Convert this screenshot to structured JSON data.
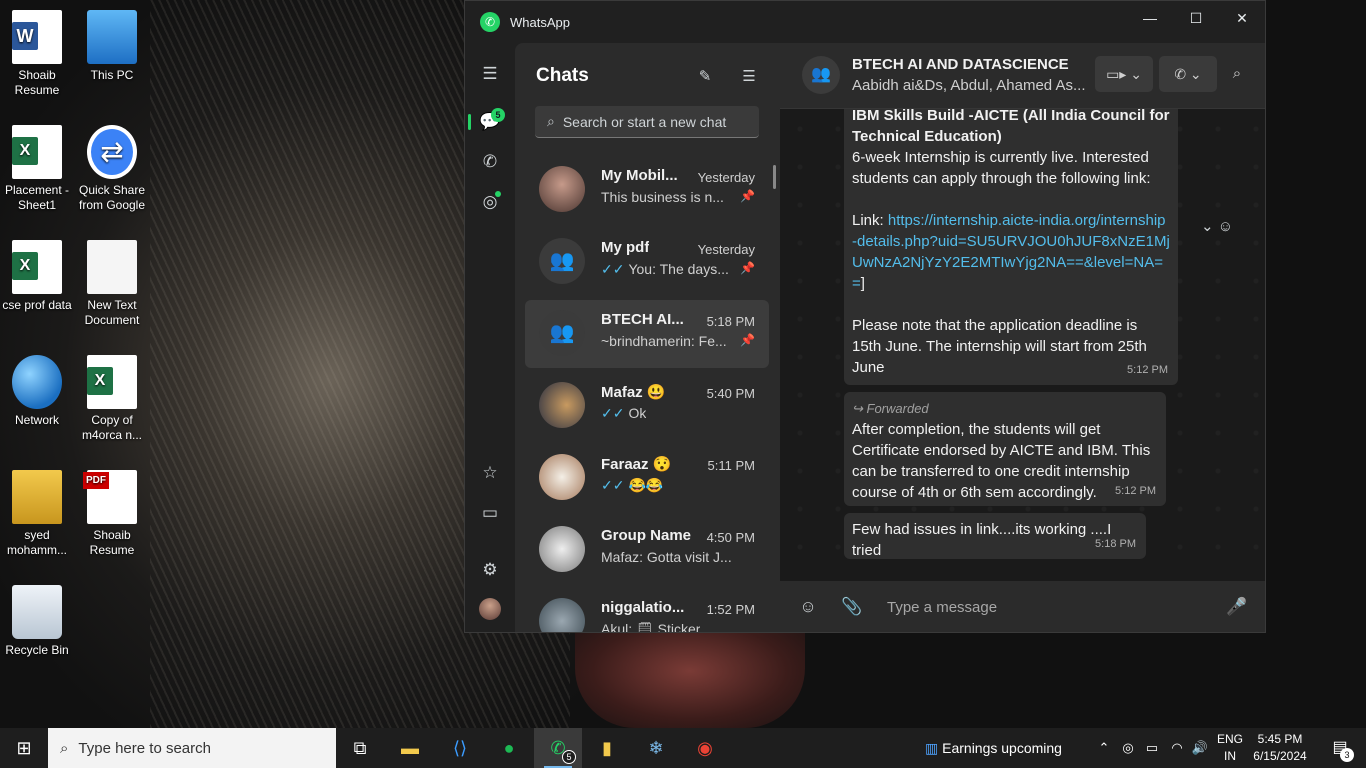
{
  "desktop": {
    "icons": [
      {
        "label": "Shoaib Resume",
        "icon": "word-icon"
      },
      {
        "label": "This PC",
        "icon": "computer-icon"
      },
      {
        "label": "Placement - Sheet1",
        "icon": "excel-icon"
      },
      {
        "label": "Quick Share from Google",
        "icon": "quick-share-icon"
      },
      {
        "label": "cse prof data",
        "icon": "excel-icon"
      },
      {
        "label": "New Text Document",
        "icon": "text-file-icon"
      },
      {
        "label": "Network",
        "icon": "network-icon"
      },
      {
        "label": "Copy of m4orca n...",
        "icon": "excel-icon"
      },
      {
        "label": "syed mohamm...",
        "icon": "user-folder-icon"
      },
      {
        "label": "Shoaib Resume",
        "icon": "pdf-icon"
      },
      {
        "label": "Recycle Bin",
        "icon": "recycle-bin-icon"
      }
    ]
  },
  "window": {
    "title": "WhatsApp",
    "controls": [
      "—",
      "☐",
      "✕"
    ]
  },
  "rail": {
    "menu_icon": "☰",
    "chats_badge": "5",
    "items": [
      "chats-icon",
      "calls-icon",
      "status-icon",
      "starred-icon",
      "archived-icon",
      "settings-icon"
    ]
  },
  "chatlist": {
    "title": "Chats",
    "search_placeholder": "Search or start a new chat",
    "chats": [
      {
        "name": "My Mobil...",
        "time": "Yesterday",
        "preview": "This business is n...",
        "ticks": false,
        "pinned": true
      },
      {
        "name": "My pdf",
        "time": "Yesterday",
        "preview": "You: The days...",
        "ticks": true,
        "pinned": true
      },
      {
        "name": "BTECH AI...",
        "time": "5:18 PM",
        "preview": "~brindhamerin: Fe...",
        "ticks": false,
        "pinned": true
      },
      {
        "name": "Mafaz 😃",
        "time": "5:40 PM",
        "preview": "Ok",
        "ticks": true,
        "pinned": false
      },
      {
        "name": "Faraaz 😯",
        "time": "5:11 PM",
        "preview": "😂😂",
        "ticks": true,
        "pinned": false
      },
      {
        "name": "Group Name",
        "time": "4:50 PM",
        "preview": "Mafaz: Gotta visit J...",
        "ticks": false,
        "pinned": false
      },
      {
        "name": "niggalatio...",
        "time": "1:52 PM",
        "preview": "Akul: 🗒 Sticker",
        "ticks": false,
        "pinned": false
      }
    ]
  },
  "conversation": {
    "title": "BTECH AI AND DATASCIENCE",
    "members": "Aabidh ai&Ds, Abdul, Ahamed As...",
    "messages": [
      {
        "bold_lines": "IBM Skills Build -AICTE (All India Council for Technical Education)",
        "text1": "6-week Internship is currently live. Interested students can apply through the following link:",
        "link_prefix": "Link: ",
        "link": "https://internship.aicte-india.org/internship-details.php?uid=SU5URVJOU0hJUF8xNzE1MjUwNzA2NjYzY2E2MTIwYjg2NA==&level=NA==",
        "link_suffix": "]",
        "text2": "Please note that the application deadline is 15th June. The internship will start from 25th June",
        "time": "5:12 PM"
      },
      {
        "forwarded": "Forwarded",
        "text": "After completion, the students will get Certificate endorsed by AICTE and IBM. This can be transferred to one credit internship course of 4th or 6th sem accordingly.",
        "time": "5:12 PM"
      },
      {
        "text": "Few had issues in link....its working ....I tried",
        "time": "5:18 PM"
      }
    ],
    "composer_placeholder": "Type a message"
  },
  "taskbar": {
    "search_placeholder": "Type here to search",
    "whatsapp_badge": "5",
    "news": "Earnings upcoming",
    "lang_top": "ENG",
    "lang_bottom": "IN",
    "time": "5:45 PM",
    "date": "6/15/2024",
    "notifications": "3"
  },
  "colors": {
    "accent": "#25d366",
    "link": "#53bdeb",
    "bubble": "#2f2f2f"
  }
}
